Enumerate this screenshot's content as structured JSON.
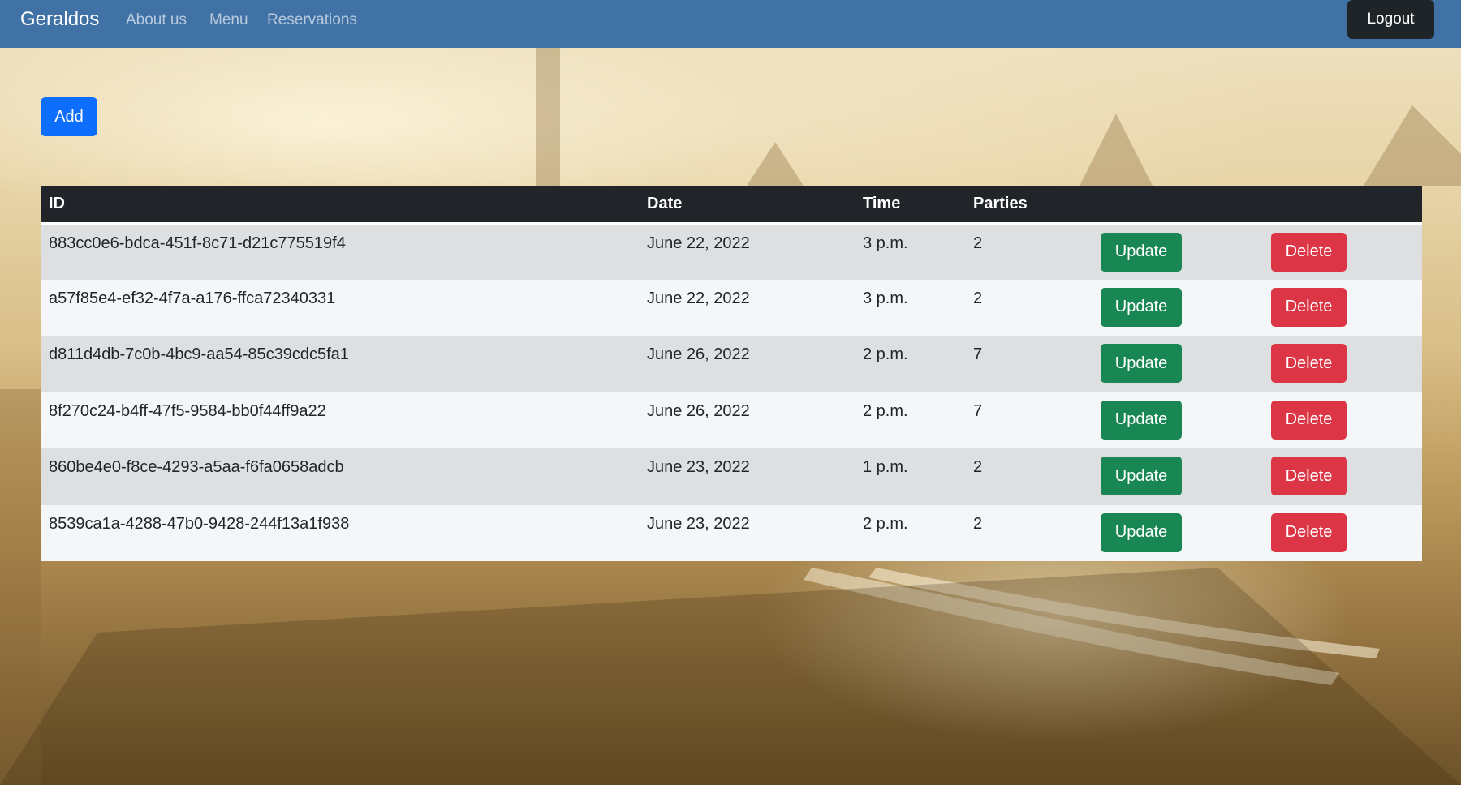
{
  "navbar": {
    "brand": "Geraldos",
    "links": [
      "About us",
      "Menu",
      "Reservations"
    ],
    "logout_label": "Logout"
  },
  "toolbar": {
    "add_label": "Add"
  },
  "table": {
    "headers": [
      "ID",
      "Date",
      "Time",
      "Parties"
    ],
    "rows": [
      {
        "id": "883cc0e6-bdca-451f-8c71-d21c775519f4",
        "date": "June 22, 2022",
        "time": "3 p.m.",
        "parties": "2",
        "update": "Update",
        "delete": "Delete"
      },
      {
        "id": "a57f85e4-ef32-4f7a-a176-ffca72340331",
        "date": "June 22, 2022",
        "time": "3 p.m.",
        "parties": "2",
        "update": "Update",
        "delete": "Delete"
      },
      {
        "id": "d811d4db-7c0b-4bc9-aa54-85c39cdc5fa1",
        "date": "June 26, 2022",
        "time": "2 p.m.",
        "parties": "7",
        "update": "Update",
        "delete": "Delete"
      },
      {
        "id": "8f270c24-b4ff-47f5-9584-bb0f44ff9a22",
        "date": "June 26, 2022",
        "time": "2 p.m.",
        "parties": "7",
        "update": "Update",
        "delete": "Delete"
      },
      {
        "id": "860be4e0-f8ce-4293-a5aa-f6fa0658adcb",
        "date": "June 23, 2022",
        "time": "1 p.m.",
        "parties": "2",
        "update": "Update",
        "delete": "Delete"
      },
      {
        "id": "8539ca1a-4288-47b0-9428-244f13a1f938",
        "date": "June 23, 2022",
        "time": "2 p.m.",
        "parties": "2",
        "update": "Update",
        "delete": "Delete"
      }
    ]
  },
  "colors": {
    "navbar": "#4172a6",
    "add": "#0d6efd",
    "update": "#198754",
    "delete": "#dc3545",
    "table_header": "#212529"
  }
}
